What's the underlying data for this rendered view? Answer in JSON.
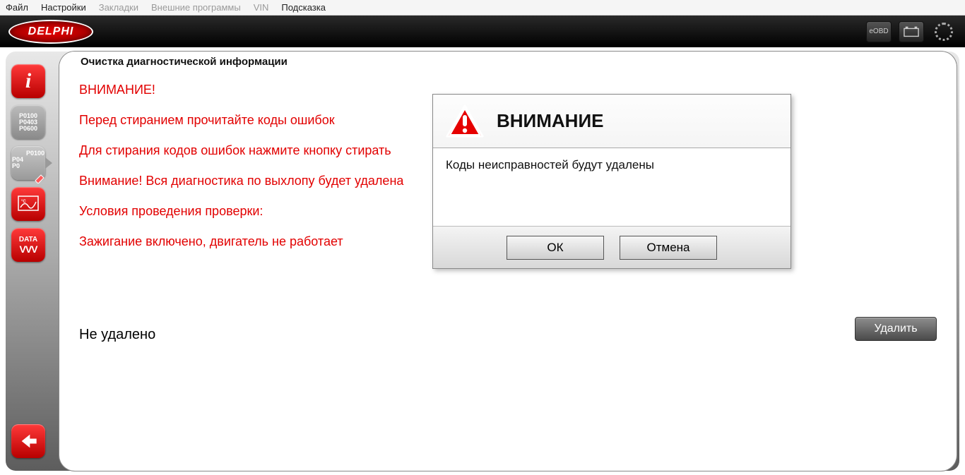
{
  "menu": {
    "file": "Файл",
    "settings": "Настройки",
    "bookmarks": "Закладки",
    "external": "Внешние программы",
    "vin": "VIN",
    "help": "Подсказка"
  },
  "header": {
    "logo": "DELPHI",
    "eobd": "eOBD"
  },
  "sidebar": {
    "codes1": "P0100\nP0403\nP0600",
    "codes2": "P0100\nP04\nP0",
    "data": "DATA",
    "vvv": "VVV"
  },
  "panel": {
    "title": "Очистка диагностической информации",
    "warn_head": "ВНИМАНИЕ!",
    "line1": "Перед стиранием прочитайте коды ошибок",
    "line2": "Для стирания кодов ошибок нажмите кнопку стирать",
    "line3": "Внимание! Вся диагностика по выхлопу будет удалена",
    "line4": "Условия проведения проверки:",
    "line5": "Зажигание включено, двигатель не работает",
    "not_deleted": "Не удалено",
    "delete_btn": "Удалить"
  },
  "dialog": {
    "title": "ВНИМАНИЕ",
    "body": "Коды неисправностей будут удалены",
    "ok": "ОК",
    "cancel": "Отмена"
  }
}
